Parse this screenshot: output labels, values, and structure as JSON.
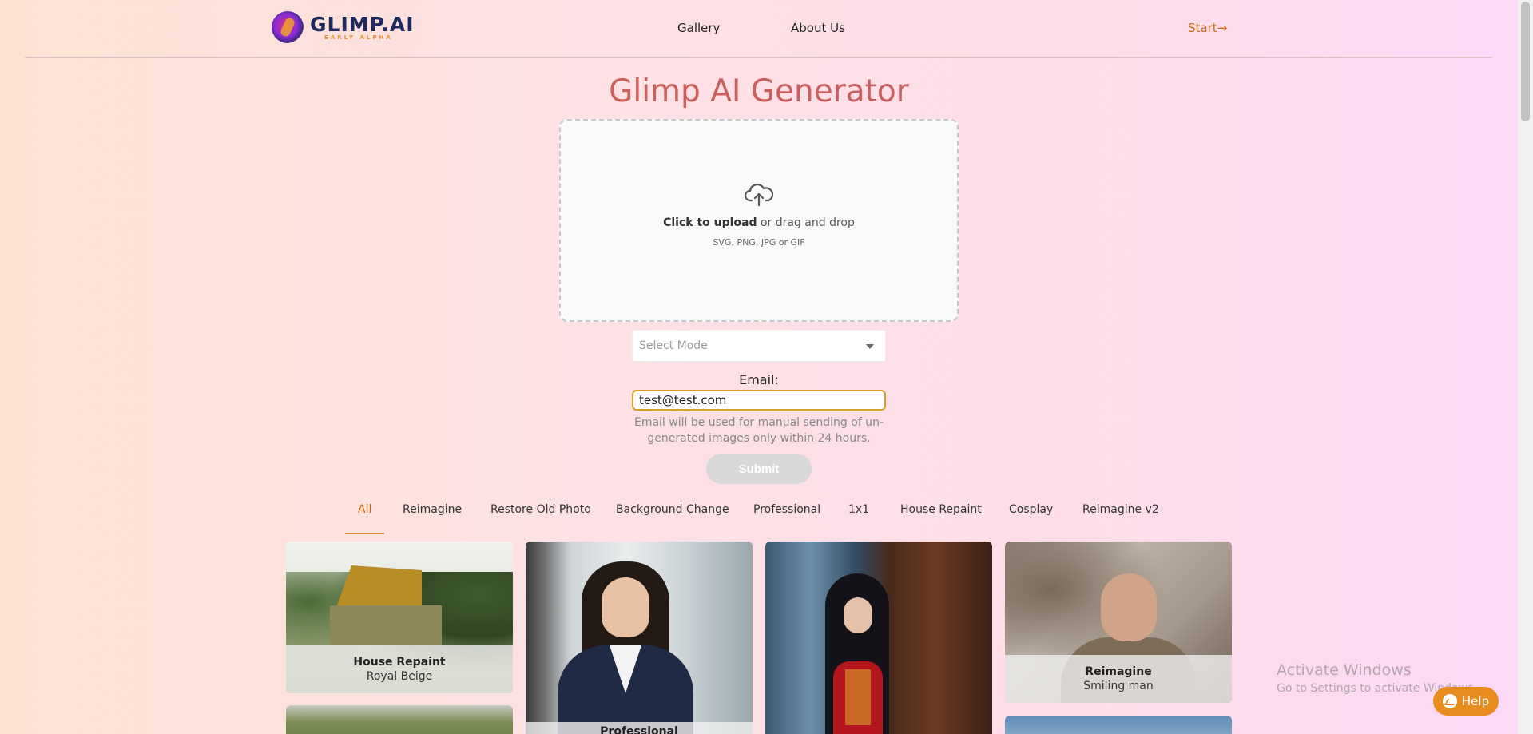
{
  "header": {
    "logo_title": "GLIMP.AI",
    "logo_subtitle": "EARLY ALPHA",
    "nav": [
      "Gallery",
      "About Us"
    ],
    "start_label": "Start→"
  },
  "main": {
    "title": "Glimp AI Generator",
    "dropzone": {
      "click_label": "Click to upload",
      "drag_label": " or drag and drop",
      "hint": "SVG, PNG, JPG or GIF",
      "icon": "cloud-upload-icon"
    },
    "mode_select": {
      "placeholder": "Select Mode"
    },
    "email": {
      "label": "Email:",
      "value": "test@test.com",
      "note": "Email will be used for manual sending of un-generated images only within 24 hours."
    },
    "submit_label": "Submit"
  },
  "tabs": [
    {
      "label": "All",
      "active": true
    },
    {
      "label": "Reimagine"
    },
    {
      "label": "Restore Old Photo"
    },
    {
      "label": "Background Change"
    },
    {
      "label": "Professional"
    },
    {
      "label": "1x1"
    },
    {
      "label": "House Repaint"
    },
    {
      "label": "Cosplay"
    },
    {
      "label": "Reimagine v2"
    }
  ],
  "gallery": [
    {
      "title": "House Repaint",
      "subtitle": "Royal Beige"
    },
    {
      "title": "Professional",
      "subtitle": ""
    },
    {
      "title": "",
      "subtitle": ""
    },
    {
      "title": "Reimagine",
      "subtitle": "Smiling man"
    }
  ],
  "watermark": {
    "line1": "Activate Windows",
    "line2": "Go to Settings to activate Windows."
  },
  "help_label": "Help",
  "colors": {
    "accent": "#c96a12",
    "help_button": "#ea8b20",
    "email_border": "#d7a024",
    "logo_navy": "#1e2a5e"
  }
}
